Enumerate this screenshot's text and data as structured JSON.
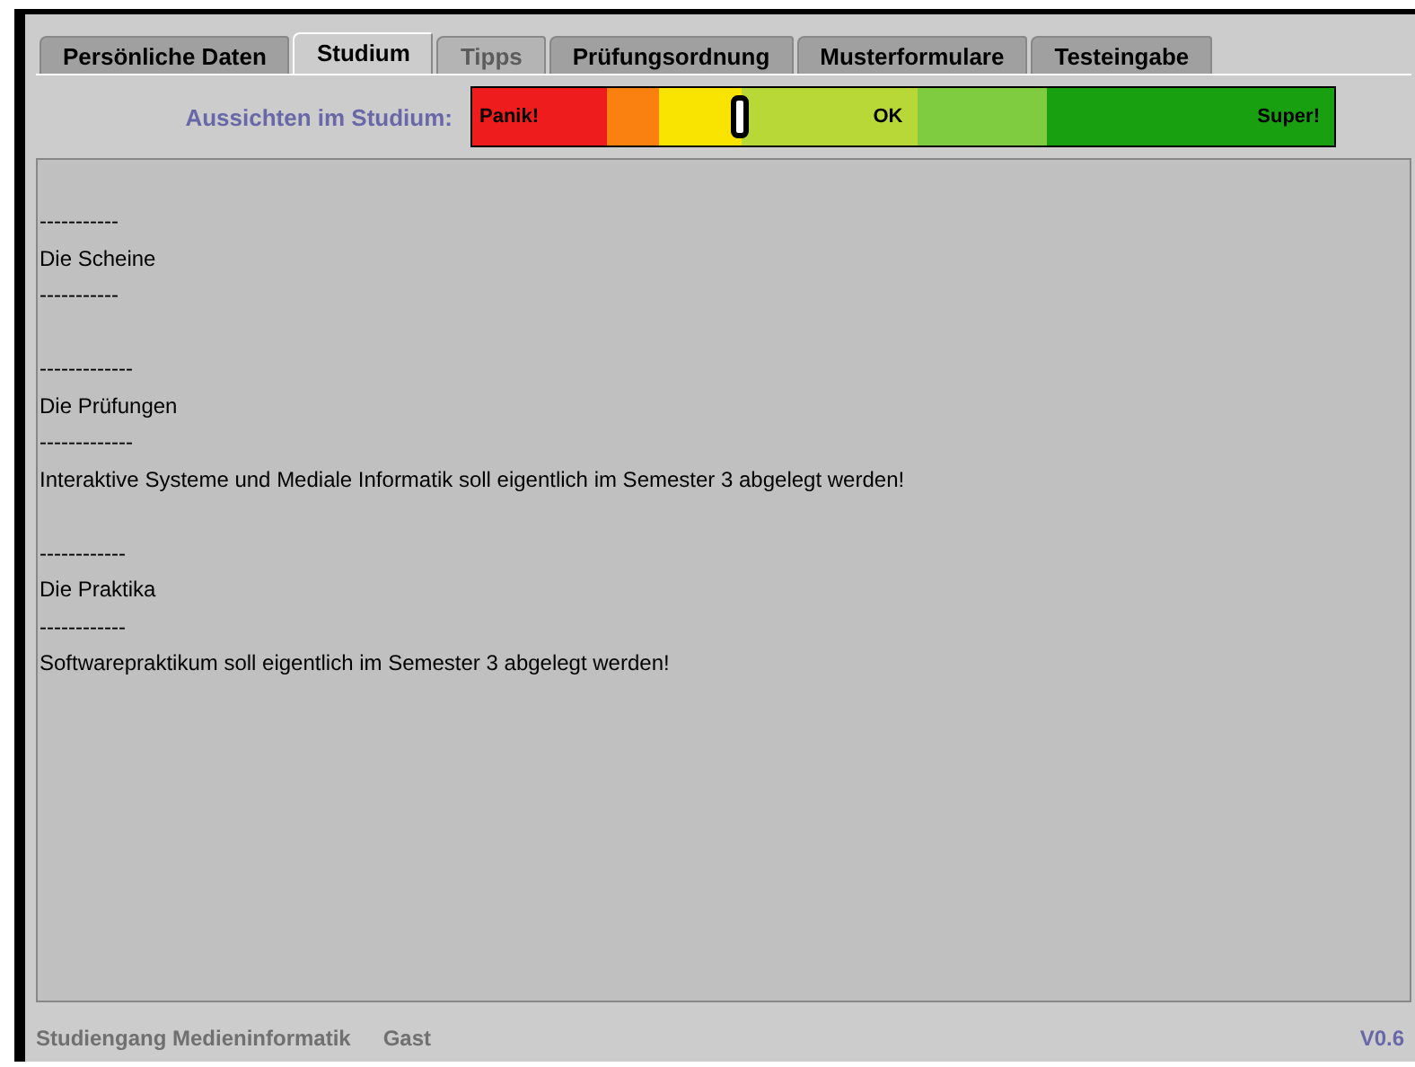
{
  "tabs": [
    {
      "label": "Persönliche Daten",
      "selected": false,
      "disabled": false
    },
    {
      "label": "Studium",
      "selected": true,
      "disabled": false
    },
    {
      "label": "Tipps",
      "selected": false,
      "disabled": true
    },
    {
      "label": "Prüfungsordnung",
      "selected": false,
      "disabled": false
    },
    {
      "label": "Musterformulare",
      "selected": false,
      "disabled": false
    },
    {
      "label": "Testeingabe",
      "selected": false,
      "disabled": false
    }
  ],
  "prospects": {
    "label": "Aussichten im Studium:",
    "level": 0.31,
    "segments": [
      {
        "color": "#ee1c1c",
        "label": "Panik!"
      },
      {
        "color": "#fa8010"
      },
      {
        "color": "#f8e400"
      },
      {
        "color": "#b8d838",
        "label": "OK"
      },
      {
        "color": "#80cc40"
      },
      {
        "color": "#18a010",
        "label": "Super!"
      }
    ]
  },
  "sections": [
    {
      "rule_top": "-----------",
      "title": "Die Scheine",
      "rule_bottom": "-----------"
    },
    {
      "rule_top": "-------------",
      "title": "Die Prüfungen",
      "rule_bottom": "-------------",
      "body": [
        "Interaktive Systeme und Mediale Informatik soll eigentlich im Semester 3 abgelegt werden!"
      ]
    },
    {
      "rule_top": "------------",
      "title": "Die Praktika",
      "rule_bottom": "------------",
      "body": [
        "Softwarepraktikum soll eigentlich im Semester 3 abgelegt werden!"
      ]
    }
  ],
  "status_bar": {
    "program": "Studiengang Medieninformatik",
    "user": "Gast",
    "version": "V0.6"
  }
}
